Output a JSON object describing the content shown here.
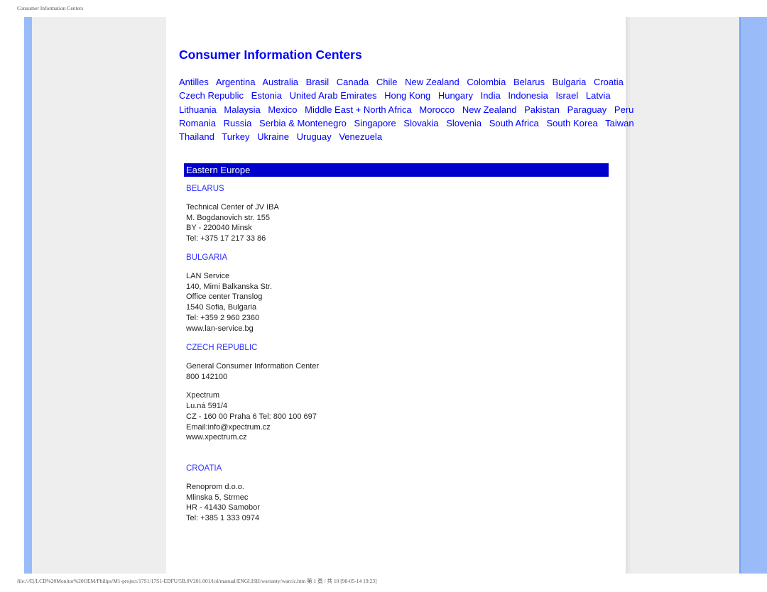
{
  "print_header": "Consumer Information Centers",
  "print_footer": "file:///E|/LCD%20Monitor%20OEM/Philips/M1-project/17S1/17S1-EDFU/5B.0V201.001/lcd/manual/ENGLISH/warranty/warcic.htm 第 1 頁 / 共 10 [98-05-14 19:23]",
  "page": {
    "title": "Consumer Information Centers",
    "country_links": [
      "Antilles",
      "Argentina",
      "Australia",
      "Brasil",
      "Canada",
      "Chile",
      "New Zealand",
      "Colombia",
      "Belarus",
      "Bulgaria",
      "Croatia",
      "Czech Republic",
      "Estonia",
      "United Arab Emirates",
      "Hong Kong",
      "Hungary",
      "India",
      "Indonesia",
      "Israel",
      "Latvia",
      "Lithuania",
      "Malaysia",
      "Mexico",
      "Middle East + North Africa",
      "Morocco",
      "New Zealand",
      "Pakistan",
      "Paraguay",
      "Peru",
      "Romania",
      "Russia",
      "Serbia & Montenegro",
      "Singapore",
      "Slovakia",
      "Slovenia",
      "South Africa",
      "South Korea",
      "Taiwan",
      "Thailand",
      "Turkey",
      "Ukraine",
      "Uruguay",
      "Venezuela"
    ],
    "region": "Eastern Europe",
    "sections": [
      {
        "heading": "BELARUS",
        "blocks": [
          [
            "Technical Center of JV IBA",
            "M. Bogdanovich str. 155",
            "BY - 220040 Minsk",
            "Tel: +375 17 217 33 86"
          ]
        ]
      },
      {
        "heading": "BULGARIA",
        "blocks": [
          [
            "LAN Service",
            "140, Mimi Balkanska Str.",
            "Office center Translog",
            "1540 Sofia, Bulgaria",
            "Tel: +359 2 960 2360",
            "www.lan-service.bg"
          ]
        ]
      },
      {
        "heading": "CZECH REPUBLIC",
        "blocks": [
          [
            "General Consumer Information Center",
            "800 142100"
          ],
          [
            "Xpectrum",
            "Lu.ná 591/4",
            "CZ - 160 00 Praha 6 Tel: 800 100 697",
            "Email:info@xpectrum.cz",
            "www.xpectrum.cz"
          ]
        ]
      },
      {
        "heading": "CROATIA",
        "blocks": [
          [
            "Renoprom d.o.o.",
            "Mlinska 5, Strmec",
            "HR - 41430 Samobor",
            "Tel: +385 1 333 0974"
          ]
        ]
      }
    ]
  },
  "colors": {
    "link": "#0000ff",
    "region_bar": "#0000cc",
    "side_stripe": "#99bbf8",
    "side_panel": "#eeeeee"
  }
}
